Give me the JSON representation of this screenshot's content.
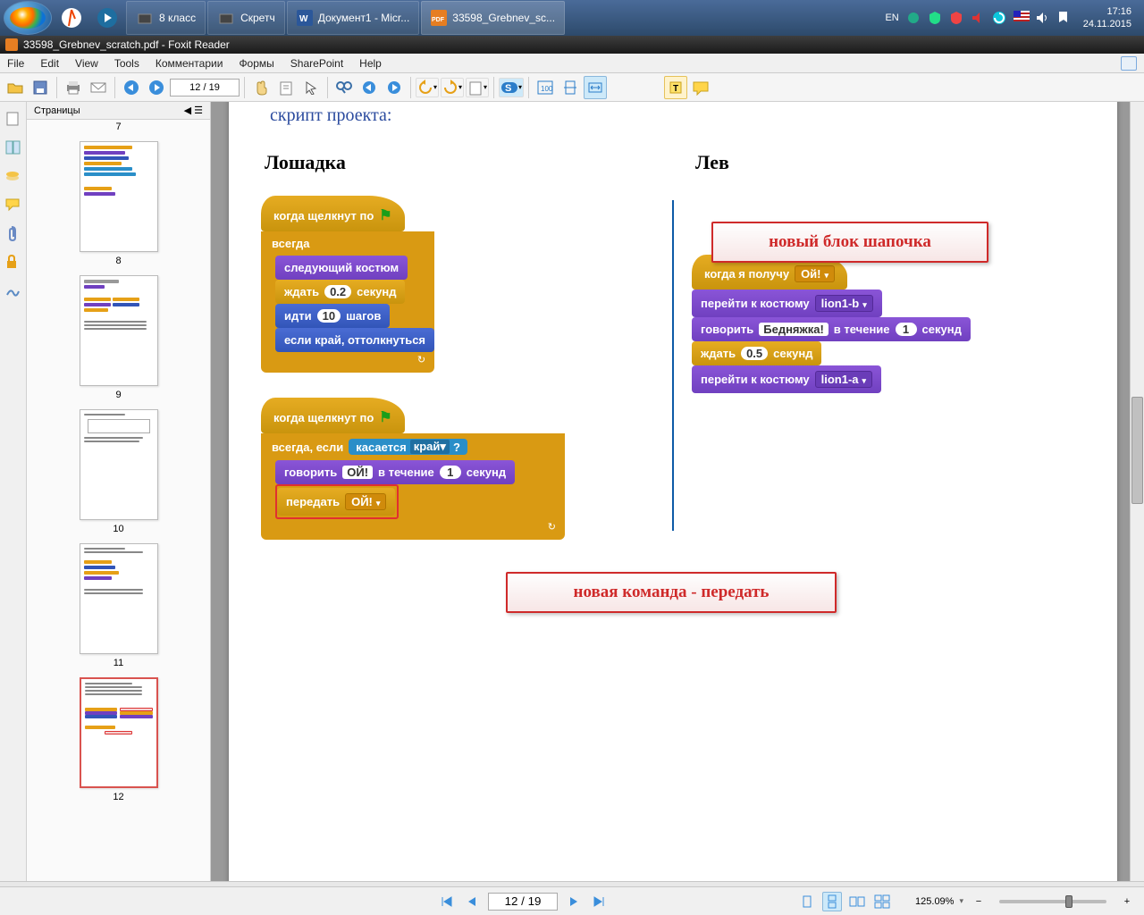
{
  "taskbar": {
    "items": [
      {
        "label": "8 класс"
      },
      {
        "label": "Скретч"
      },
      {
        "label": "Документ1 - Micr..."
      },
      {
        "label": "33598_Grebnev_sc..."
      }
    ],
    "lang": "EN",
    "time": "17:16",
    "date": "24.11.2015"
  },
  "window": {
    "title": "33598_Grebnev_scratch.pdf - Foxit Reader"
  },
  "menu": {
    "items": [
      "File",
      "Edit",
      "View",
      "Tools",
      "Комментарии",
      "Формы",
      "SharePoint",
      "Help"
    ]
  },
  "toolbar": {
    "page": "12 / 19"
  },
  "thumbs": {
    "title": "Страницы",
    "labels": [
      "7",
      "8",
      "9",
      "10",
      "11",
      "12"
    ]
  },
  "doc": {
    "title": "скрипт проекта:",
    "left_h": "Лошадка",
    "right_h": "Лев",
    "callout1": "новый блок шапочка",
    "callout2": "новая команда - передать",
    "s1": {
      "hat": "когда щелкнут по",
      "forever": "всегда",
      "b1": "следующий костюм",
      "b2_a": "ждать",
      "b2_v": "0.2",
      "b2_b": "секунд",
      "b3_a": "идти",
      "b3_v": "10",
      "b3_b": "шагов",
      "b4": "если край, оттолкнуться"
    },
    "s2": {
      "hat": "когда щелкнут по",
      "forever": "всегда, если",
      "cond_a": "касается",
      "cond_v": "край",
      "q": "?",
      "b1_a": "говорить",
      "b1_v": "ОЙ!",
      "b1_b": "в течение",
      "b1_n": "1",
      "b1_c": "секунд",
      "b2_a": "передать",
      "b2_v": "ОЙ!"
    },
    "s3": {
      "hat": "когда я получу",
      "hat_v": "Ой!",
      "b1_a": "перейти к костюму",
      "b1_v": "lion1-b",
      "b2_a": "говорить",
      "b2_v": "Бедняжка!",
      "b2_b": "в течение",
      "b2_n": "1",
      "b2_c": "секунд",
      "b3_a": "ждать",
      "b3_v": "0.5",
      "b3_b": "секунд",
      "b4_a": "перейти к костюму",
      "b4_v": "lion1-a"
    }
  },
  "status": {
    "page": "12 / 19",
    "zoom": "125.09%"
  }
}
